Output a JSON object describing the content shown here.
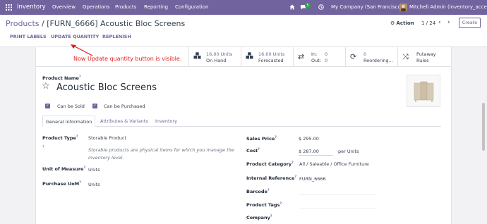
{
  "navbar": {
    "app_name": "Inventory",
    "menu": [
      "Overview",
      "Operations",
      "Products",
      "Reporting",
      "Configuration"
    ],
    "chat_count": "5",
    "company": "My Company (San Francisco)",
    "user": "Mitchell Admin (inventory_access)"
  },
  "breadcrumb": {
    "root": "Products",
    "separator": "/",
    "current": "[FURN_6666] Acoustic Bloc Screens"
  },
  "control": {
    "action_label": "Action",
    "pager": "1 / 24",
    "create_label": "Create",
    "buttons": [
      "PRINT LABELS",
      "UPDATE QUANTITY",
      "REPLENISH"
    ]
  },
  "annotation": "Now Update quantity button is visible.",
  "smart_buttons": {
    "on_hand_value": "16.00 Units",
    "on_hand_label": "On Hand",
    "forecasted_value": "16.00 Units",
    "forecasted_label": "Forecasted",
    "in_label": "In:",
    "in_value": "0",
    "out_label": "Out:",
    "out_value": "0",
    "reordering_value": "0",
    "reordering_label": "Reordering...",
    "putaway_line1": "Putaway",
    "putaway_line2": "Rules"
  },
  "product": {
    "name_label": "Product Name",
    "name": "Acoustic Bloc Screens",
    "can_be_sold": "Can be Sold",
    "can_be_purchased": "Can be Purchased"
  },
  "tabs": [
    "General Information",
    "Attributes & Variants",
    "Inventory"
  ],
  "left_fields": {
    "product_type_label": "Product Type",
    "product_type_value": "Storable Product",
    "product_type_help_1": "Storable products are physical items for which you manage the",
    "product_type_help_2": "inventory level.",
    "uom_label": "Unit of Measure",
    "uom_value": "Units",
    "purchase_uom_label": "Purchase UoM",
    "purchase_uom_value": "Units"
  },
  "right_fields": {
    "sales_price_label": "Sales Price",
    "sales_price_value": "$ 295.00",
    "cost_label": "Cost",
    "cost_value": "$ 287.00",
    "cost_unit": "per Units",
    "category_label": "Product Category",
    "category_value": "All / Saleable / Office Furniture",
    "internal_ref_label": "Internal Reference",
    "internal_ref_value": "FURN_6666",
    "barcode_label": "Barcode",
    "tags_label": "Product Tags",
    "company_label": "Company"
  },
  "colors": {
    "brand": "#71639e",
    "annotation_red": "#e02020"
  }
}
